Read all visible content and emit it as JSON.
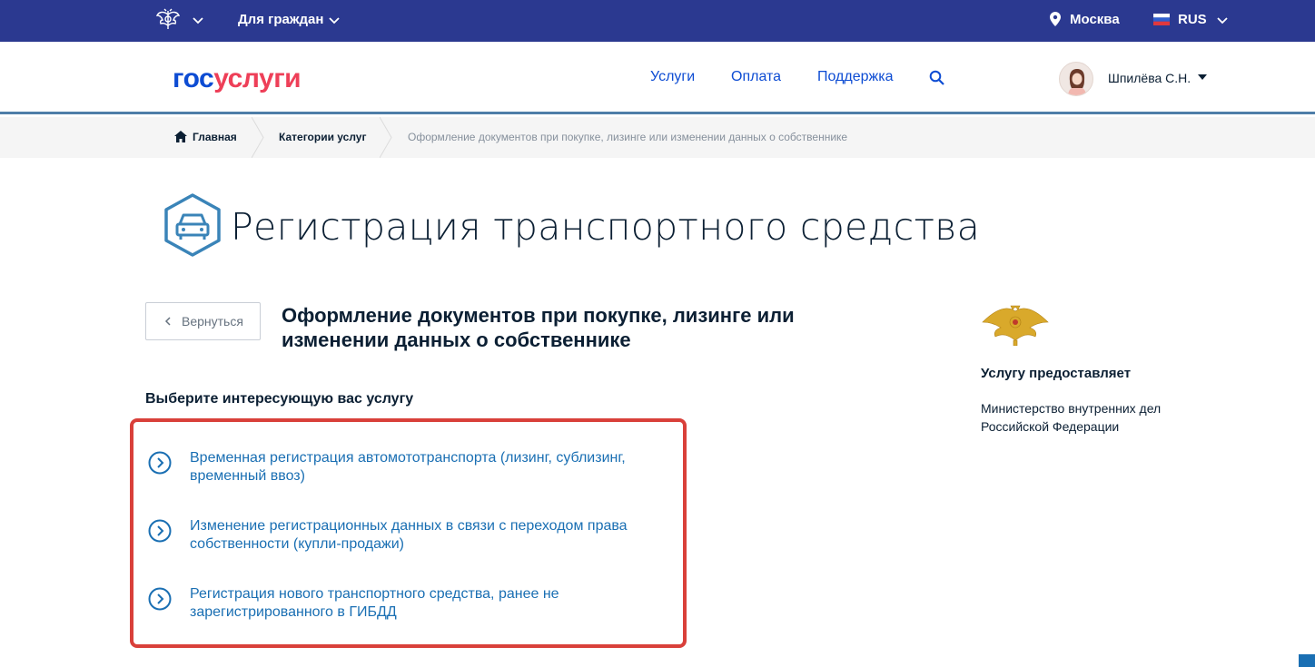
{
  "topbar": {
    "audience_label": "Для граждан",
    "city": "Москва",
    "language": "RUS"
  },
  "header": {
    "logo_part1": "гос",
    "logo_part2": "услуги",
    "nav": [
      "Услуги",
      "Оплата",
      "Поддержка"
    ],
    "user_name": "Шпилёва С.Н."
  },
  "breadcrumb": {
    "home": "Главная",
    "category": "Категории услуг",
    "current": "Оформление документов при покупке, лизинге или изменении данных о собственнике"
  },
  "page": {
    "title": "Регистрация транспортного средства",
    "back_label": "Вернуться",
    "subtitle": "Оформление документов при покупке, лизинге или изменении данных о собственнике",
    "choose_label": "Выберите интересующую вас услугу",
    "services": [
      {
        "label": "Временная регистрация автомототранспорта (лизинг, сублизинг, временный ввоз)"
      },
      {
        "label": "Изменение регистрационных данных в связи с переходом права собственности (купли-продажи)"
      },
      {
        "label": "Регистрация нового транспортного средства, ранее не зарегистрированного в ГИБДД"
      }
    ]
  },
  "provider": {
    "label": "Услугу предоставляет",
    "name": "Министерство внутренних дел Российской Федерации"
  },
  "icons": {
    "emblem": "coat-of-arms-icon",
    "location": "location-pin-icon",
    "flag": "russian-flag-icon",
    "search": "search-icon",
    "home": "home-icon",
    "car": "car-icon",
    "service_arrow": "chevron-right-circle-icon"
  },
  "colors": {
    "topbar": "#2b3990",
    "brand_blue": "#0d4cd3",
    "brand_red": "#ee3f58",
    "link": "#1a6fb3",
    "highlight_border": "#d9403a"
  }
}
